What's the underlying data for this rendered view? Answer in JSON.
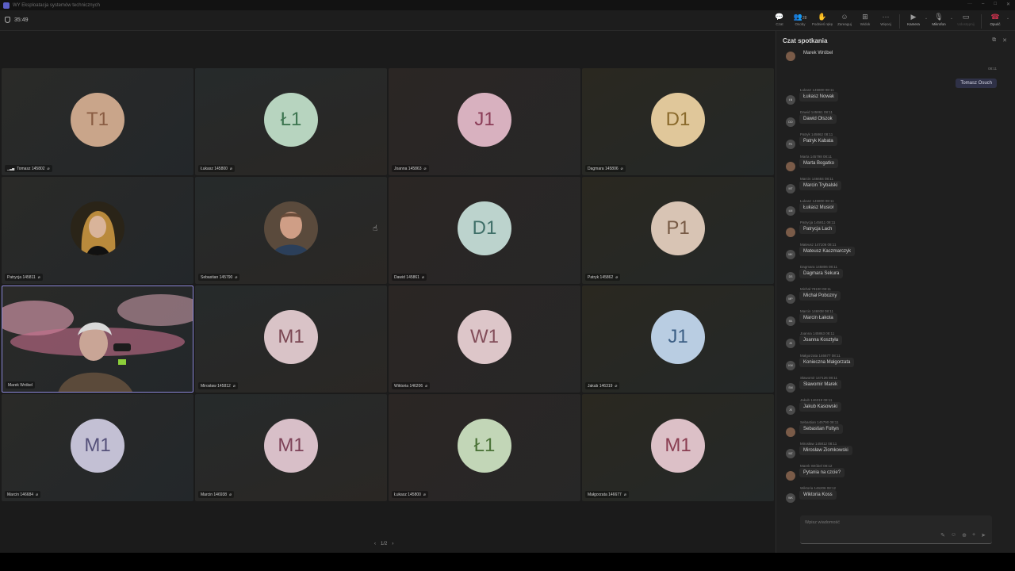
{
  "window": {
    "title": "WY Eksploatacja systemów technicznych",
    "controls": [
      "···",
      "–",
      "□",
      "✕"
    ]
  },
  "toolbar": {
    "timer": "35:49",
    "tools": [
      {
        "name": "chat",
        "label": "Czat",
        "icon": "💬"
      },
      {
        "name": "people",
        "label": "Osoby",
        "icon": "👥",
        "count": "28"
      },
      {
        "name": "raise-hand",
        "label": "Podnieś rękę",
        "icon": "✋"
      },
      {
        "name": "react",
        "label": "Zareaguj",
        "icon": "☺"
      },
      {
        "name": "view",
        "label": "Widok",
        "icon": "⊞"
      },
      {
        "name": "more",
        "label": "Więcej",
        "icon": "···"
      }
    ],
    "camera_label": "Kamera",
    "mic_label": "Mikrofon",
    "share_label": "Udostępnij",
    "leave_label": "Opuść"
  },
  "tiles": [
    {
      "initials": "T1",
      "name": "Tomasz 145802",
      "bg": "#c9a58a",
      "fg": "#8a5d43",
      "signal": true
    },
    {
      "initials": "Ł1",
      "name": "Łukasz 145800",
      "bg": "#b7d4bf",
      "fg": "#3d7550"
    },
    {
      "initials": "J1",
      "name": "Joanna 145863",
      "bg": "#d8b1bf",
      "fg": "#8b3d58"
    },
    {
      "initials": "D1",
      "name": "Dagmara 145806",
      "bg": "#e0c79a",
      "fg": "#8a6a2c"
    },
    {
      "photo": "female",
      "name": "Patrycja 145811"
    },
    {
      "photo": "male",
      "name": "Sebastian 145790"
    },
    {
      "initials": "D1",
      "name": "Dawid 145861",
      "bg": "#bcd3cd",
      "fg": "#3f6f68"
    },
    {
      "initials": "P1",
      "name": "Patryk 145862",
      "bg": "#d8c4b4",
      "fg": "#775a45"
    },
    {
      "video": true,
      "name": "Marek Wróbel",
      "speaking": true
    },
    {
      "initials": "M1",
      "name": "Mirosław 145812",
      "bg": "#d9c3c7",
      "fg": "#7b4753"
    },
    {
      "initials": "W1",
      "name": "Wiktoria 146206",
      "bg": "#ddc6c9",
      "fg": "#834e5a"
    },
    {
      "initials": "J1",
      "name": "Jakub 146319",
      "bg": "#b9cde2",
      "fg": "#3c5f85"
    },
    {
      "initials": "M1",
      "name": "Marcin 146684",
      "bg": "#c3c0d4",
      "fg": "#55517a"
    },
    {
      "initials": "M1",
      "name": "Marcin 146938",
      "bg": "#d8bfc8",
      "fg": "#7d4258"
    },
    {
      "initials": "Ł1",
      "name": "Łukasz 145800",
      "bg": "#c2d6b7",
      "fg": "#4b7338"
    },
    {
      "initials": "M1",
      "name": "Małgorzata 146677",
      "bg": "#dcc0c7",
      "fg": "#8a3e52"
    }
  ],
  "pager": {
    "prev": "‹",
    "label": "1/2",
    "next": "›"
  },
  "chat": {
    "title": "Czat spotkania",
    "first": {
      "text": "Marek Wróbel"
    },
    "self": {
      "time": "08:11",
      "text": "Tomasz Osuch"
    },
    "messages": [
      {
        "av": "ŁN",
        "meta": "Łukasz 145800  08:11",
        "text": "Łukasz Nowak"
      },
      {
        "av": "DO",
        "meta": "Dawid 145861  08:11",
        "text": "Dawid Olszok"
      },
      {
        "av": "PK",
        "meta": "Patryk 145862  08:11",
        "text": "Patryk Kabata"
      },
      {
        "av": "MB",
        "meta": "Marta 145798  08:11",
        "text": "Marta Bogatko",
        "photo": true
      },
      {
        "av": "MT",
        "meta": "Marcin 146684  08:11",
        "text": "Marcin Trybalski"
      },
      {
        "av": "ŁM",
        "meta": "Łukasz 145800  08:11",
        "text": "Łukasz Musioł"
      },
      {
        "av": "PL",
        "meta": "Patrycja 145811  08:11",
        "text": "Patrycja Lach",
        "photo": true
      },
      {
        "av": "MK",
        "meta": "Mateusz 147106  08:11",
        "text": "Mateusz Kaczmarczyk"
      },
      {
        "av": "DS",
        "meta": "Dagmara 145806  08:11",
        "text": "Dagmara Sekura"
      },
      {
        "av": "MP",
        "meta": "Michał 79100  08:11",
        "text": "Michał Pobozny"
      },
      {
        "av": "MŁ",
        "meta": "Marcin 146938  08:11",
        "text": "Marcin Łakota"
      },
      {
        "av": "JK",
        "meta": "Joanna 145863  08:11",
        "text": "Joanna Kosztyła"
      },
      {
        "av": "KM",
        "meta": "Małgorzata 146677  08:11",
        "text": "Konieczna Małgorzata"
      },
      {
        "av": "SM",
        "meta": "Sławomir 147126  08:11",
        "text": "Sławomir Marek"
      },
      {
        "av": "JK",
        "meta": "Jakub 146319  08:11",
        "text": "Jakub Kasowski"
      },
      {
        "av": "SF",
        "meta": "Sebastian 145790  08:11",
        "text": "Sebastian Foltyn",
        "photo": true
      },
      {
        "av": "MZ",
        "meta": "Mirosław 145812  08:11",
        "text": "Mirosław Ziomkowski"
      },
      {
        "av": "MW",
        "meta": "Marek Wróbel  08:12",
        "text": "Pytania na czcie?",
        "photo": true
      },
      {
        "av": "WK",
        "meta": "Wiktoria 146206  08:12",
        "text": "Wiktoria Koss"
      }
    ],
    "compose_placeholder": "Wpisz wiadomość",
    "compose_icons": [
      "✎",
      "☺",
      "⊕",
      "+",
      "➤"
    ]
  }
}
